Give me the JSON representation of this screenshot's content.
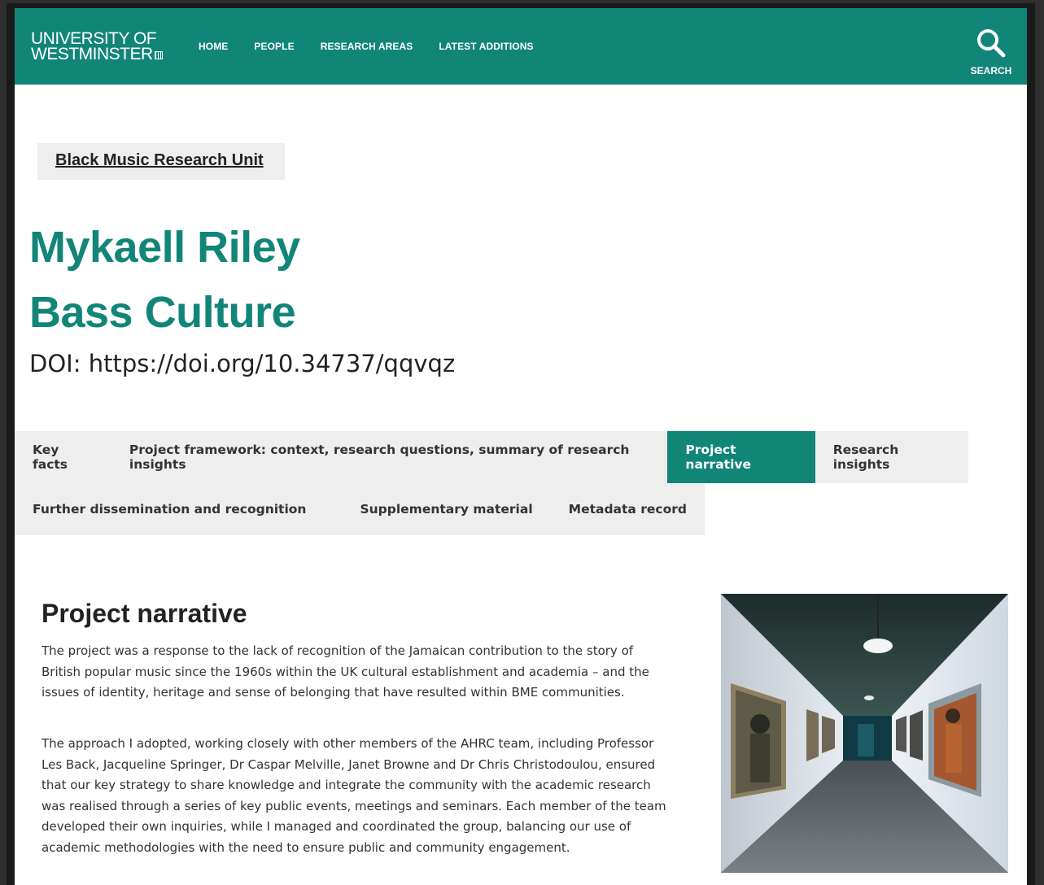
{
  "header": {
    "logo_line1": "UNIVERSITY OF",
    "logo_line2": "WESTMINSTER",
    "nav": [
      "HOME",
      "PEOPLE",
      "RESEARCH AREAS",
      "LATEST ADDITIONS"
    ],
    "search_label": "SEARCH"
  },
  "breadcrumb": "Black Music Research Unit",
  "title_line1": "Mykaell Riley",
  "title_line2": "Bass Culture",
  "doi": "DOI: https://doi.org/10.34737/qqvqz",
  "tabs": {
    "row1": [
      "Key facts",
      "Project framework: context, research questions, summary of research insights",
      "Project narrative",
      "Research insights"
    ],
    "row2": [
      "Further dissemination and recognition",
      "Supplementary material",
      "Metadata record"
    ],
    "active": "Project narrative"
  },
  "narrative": {
    "heading": "Project narrative",
    "p1": "The project was a response to the lack of recognition of the Jamaican contribution to the story of British popular music since the 1960s within the UK cultural establishment and academia – and the issues of identity, heritage and sense of belonging that have resulted within BME communities.",
    "p2": "The approach I adopted, working closely with other members of the AHRC team, including Professor Les Back, Jacqueline Springer, Dr Caspar Melville, Janet Browne and Dr Chris Christodoulou, ensured that our key strategy to share knowledge and integrate the community with the academic research was realised through a series of key public events, meetings and seminars. Each member of the team developed their own inquiries, while I managed and coordinated the group, balancing our use of academic methodologies with the need to ensure public and community engagement."
  },
  "colors": {
    "brand": "#128579",
    "tab_bg": "#eeeeee"
  },
  "icons": [
    "search-icon",
    "photo-exhibition-corridor"
  ]
}
